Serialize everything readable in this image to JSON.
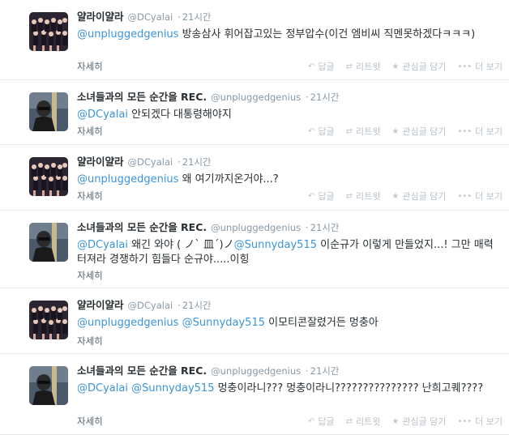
{
  "tweets": [
    {
      "fullname": "얄라이얄라",
      "username": "@DCyalai",
      "dot": "·",
      "time": "21시간",
      "mention1": "@unpluggedgenius",
      "body": " 방송삼사 휘어잡고있는 정부압수(이건 엠비씨 직멘못하겠다ㅋㅋㅋ)",
      "expand": "자세히",
      "avatar": "group"
    },
    {
      "fullname": "소녀들과의 모든 순간을 REC.",
      "username": "@unpluggedgenius",
      "dot": "·",
      "time": "21시간",
      "mention1": "@DCyalai",
      "body": " 안되겠다 대통령해야지",
      "expand": "자세히",
      "avatar": "person"
    },
    {
      "fullname": "얄라이얄라",
      "username": "@DCyalai",
      "dot": "·",
      "time": "21시간",
      "mention1": "@unpluggedgenius",
      "body": " 왜 여기까지온거야...?",
      "expand": "자세히",
      "avatar": "group"
    },
    {
      "fullname": "소녀들과의 모든 순간을 REC.",
      "username": "@unpluggedgenius",
      "dot": "·",
      "time": "21시간",
      "mention1": "@DCyalai",
      "middle": " 왜긴 와야 ( ノ` 皿´)ノ",
      "mention2": "@Sunnyday515",
      "body": " 이순규가 이렇게 만들었지...! 그만 매력터져라 경쟁하기 힘들다 순규야.....이힝",
      "expand": "자세히",
      "avatar": "person"
    },
    {
      "fullname": "얄라이얄라",
      "username": "@DCyalai",
      "dot": "·",
      "time": "21시간",
      "mention1": "@unpluggedgenius",
      "middle": " ",
      "mention2": "@Sunnyday515",
      "body": " 이모티콘잘렸거든 멍충아",
      "expand": "자세히",
      "avatar": "group"
    },
    {
      "fullname": "소녀들과의 모든 순간을 REC.",
      "username": "@unpluggedgenius",
      "dot": "·",
      "time": "21시간",
      "mention1": "@DCyalai",
      "middle": " ",
      "mention2": "@Sunnyday515",
      "body": " 멍충이라니??? 멍충이라니??????????????? 난희고퀘????",
      "expand": "자세히",
      "avatar": "person"
    }
  ],
  "actions": {
    "reply": "답글",
    "retweet": "리트윗",
    "favorite": "관심글 담기",
    "more": "더 보기"
  },
  "icons": {
    "reply": "reply-icon",
    "retweet": "retweet-icon",
    "favorite": "star-icon",
    "more": "more-dots-icon"
  },
  "colors": {
    "mention": "#3b94d9",
    "meta": "#8899a6",
    "action": "#b8c2c9"
  }
}
